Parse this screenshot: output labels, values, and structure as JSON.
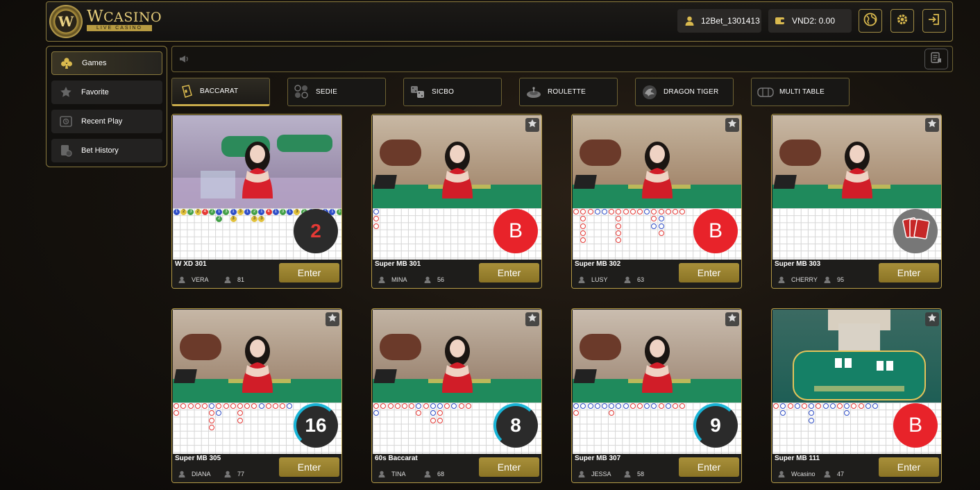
{
  "brand": {
    "emblem": "W",
    "name_w": "W",
    "name_rest": "CASINO",
    "sub": "LIVE CASINO"
  },
  "header": {
    "username": "12Bet_1301413",
    "balance": "VND2: 0.00",
    "icons": [
      "user-icon",
      "wallet-icon",
      "globe-icon",
      "gear-icon",
      "logout-icon"
    ]
  },
  "sidebar": {
    "items": [
      {
        "label": "Games",
        "icon": "club-icon"
      },
      {
        "label": "Favorite",
        "icon": "star-icon"
      },
      {
        "label": "Recent Play",
        "icon": "history-icon"
      },
      {
        "label": "Bet History",
        "icon": "document-icon"
      }
    ]
  },
  "tabs": [
    {
      "label": "BACCARAT",
      "icon": "baccarat-icon"
    },
    {
      "label": "SEDIE",
      "icon": "sedie-icon"
    },
    {
      "label": "SICBO",
      "icon": "dice-icon"
    },
    {
      "label": "ROULETTE",
      "icon": "roulette-icon"
    },
    {
      "label": "DRAGON TIGER",
      "icon": "dragon-icon"
    },
    {
      "label": "MULTI TABLE",
      "icon": "multi-table-icon"
    }
  ],
  "enter_label": "Enter",
  "tables": [
    {
      "name": "W XD 301",
      "dealer": "VERA",
      "players": "81",
      "badge": "2"
    },
    {
      "name": "Super MB 301",
      "dealer": "MINA",
      "players": "56",
      "badge": "B"
    },
    {
      "name": "Super MB 302",
      "dealer": "LUSY",
      "players": "63",
      "badge": "B"
    },
    {
      "name": "Super MB 303",
      "dealer": "CHERRY",
      "players": "95",
      "badge": ""
    },
    {
      "name": "Super MB 305",
      "dealer": "DIANA",
      "players": "77",
      "badge": "16"
    },
    {
      "name": "60s Baccarat",
      "dealer": "TINA",
      "players": "68",
      "badge": "8"
    },
    {
      "name": "Super MB 307",
      "dealer": "JESSA",
      "players": "58",
      "badge": "9"
    },
    {
      "name": "Super MB 111",
      "dealer": "Wcasino",
      "players": "47",
      "badge": "B"
    }
  ],
  "colors": {
    "gold": "#b59c48",
    "enter": "#a08a32",
    "banker": "#e8232a",
    "timer_ring": "#19b4d6"
  }
}
